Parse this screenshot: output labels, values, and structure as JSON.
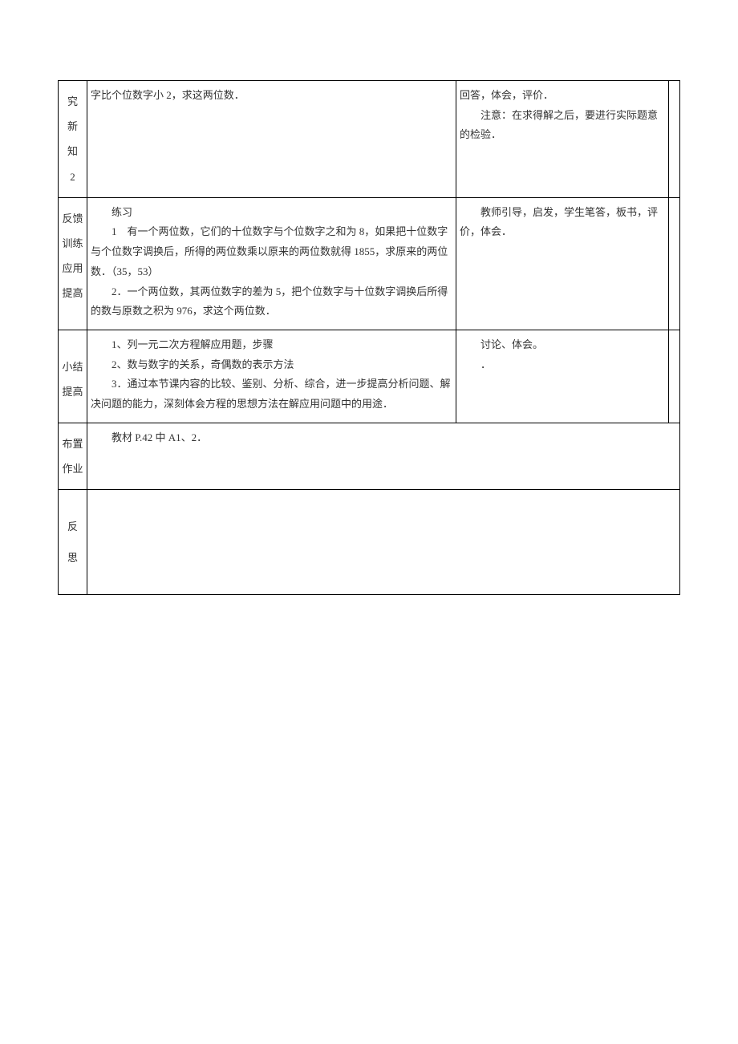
{
  "rows": {
    "r1": {
      "label_chars": [
        "究",
        "新",
        "知",
        "2"
      ],
      "content_line1": "字比个位数字小 2，求这两位数．",
      "right_line1": "回答，体会，评价．",
      "right_line2": "注意：在求得解之后，要进行实际题意的检验．"
    },
    "r2": {
      "label_chars": [
        "反馈",
        "训练",
        "应用",
        "提高"
      ],
      "content_title": "练习",
      "content_p1": "1　有一个两位数，它们的十位数字与个位数字之和为 8，如果把十位数字与个位数字调换后，所得的两位数乘以原来的两位数就得 1855，求原来的两位数．（35，53）",
      "content_p2": "2．一个两位数，其两位数字的差为 5，把个位数字与十位数字调换后所得的数与原数之积为 976，求这个两位数．",
      "right_p1": "教师引导，启发，学生笔答，板书，评价，体会．"
    },
    "r3": {
      "label_chars": [
        "小结",
        "提高"
      ],
      "content_p1": "1、列一元二次方程解应用题，步骤",
      "content_p2": "2、数与数字的关系，奇偶数的表示方法",
      "content_p3": "3．通过本节课内容的比较、鉴别、分析、综合，进一步提高分析问题、解决问题的能力，深刻体会方程的思想方法在解应用问题中的用途．",
      "right_p1": "讨论、体会。",
      "right_p2": "．"
    },
    "r4": {
      "label_chars": [
        "布置",
        "作业"
      ],
      "content_p1": "教材 P.42 中 A1、2．"
    },
    "r5": {
      "label_chars": [
        "反",
        "思"
      ]
    }
  }
}
